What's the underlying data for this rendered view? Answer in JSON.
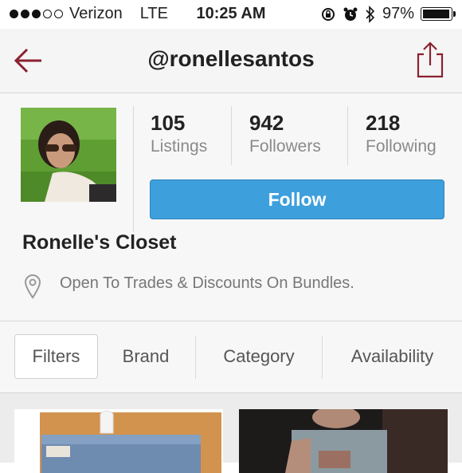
{
  "status_bar": {
    "carrier": "Verizon",
    "network": "LTE",
    "time": "10:25 AM",
    "battery": "97%",
    "signal_bars": 3,
    "battery_level": 0.97
  },
  "nav": {
    "title": "@ronellesantos",
    "back_icon": "back-arrow-icon",
    "share_icon": "share-icon"
  },
  "profile": {
    "stats": [
      {
        "value": "105",
        "label": "Listings"
      },
      {
        "value": "942",
        "label": "Followers"
      },
      {
        "value": "218",
        "label": "Following"
      }
    ],
    "follow_label": "Follow",
    "closet_name": "Ronelle's Closet",
    "description": "Open To Trades & Discounts On Bundles."
  },
  "filters": [
    "Filters",
    "Brand",
    "Category",
    "Availability"
  ],
  "colors": {
    "accent_red": "#8b2130",
    "follow_blue": "#3d9fdc"
  }
}
